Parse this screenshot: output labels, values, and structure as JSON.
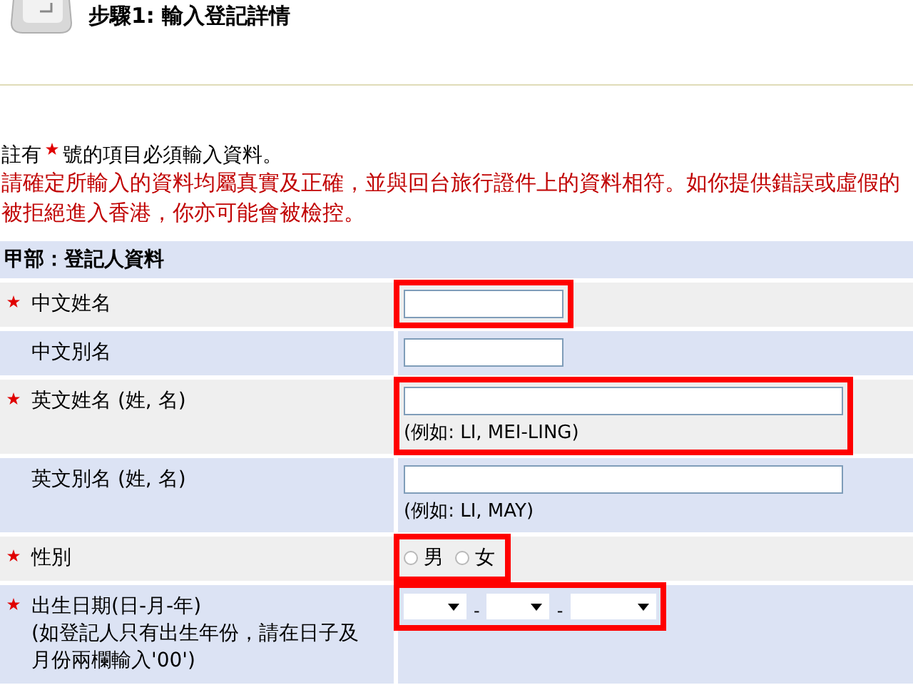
{
  "header": {
    "title": "步驟1: 輸入登記詳情"
  },
  "note": {
    "text_before": "註有",
    "text_after": "號的項目必須輸入資料。"
  },
  "warning_lines": [
    "請確定所輸入的資料均屬真實及正確，並與回台旅行證件上的資料相符。如你提供錯誤或虛假的",
    "被拒絕進入香港，你亦可能會被檢控。"
  ],
  "form": {
    "section_title": "甲部：登記人資料",
    "rows": [
      {
        "kind": "short_text",
        "label": "中文姓名",
        "required": true,
        "highlighted": true
      },
      {
        "kind": "short_text",
        "label": "中文別名",
        "required": false,
        "highlighted": false
      },
      {
        "kind": "long_text",
        "label": "英文姓名 (姓, 名)",
        "required": true,
        "highlighted": true,
        "example": "(例如: LI, MEI-LING)"
      },
      {
        "kind": "long_text",
        "label": "英文別名 (姓, 名)",
        "required": false,
        "highlighted": false,
        "example": "(例如: LI, MAY)"
      },
      {
        "kind": "radio",
        "label": "性別",
        "required": true,
        "highlighted": true,
        "options": [
          {
            "label": "男",
            "selected": false
          },
          {
            "label": "女",
            "selected": false
          }
        ]
      },
      {
        "kind": "date",
        "label": "出生日期(日-月-年)",
        "note": "(如登記人只有出生年份，請在日子及月份兩欄輸入'00')",
        "required": true,
        "highlighted": true,
        "separators": [
          "-",
          "-"
        ]
      }
    ]
  }
}
